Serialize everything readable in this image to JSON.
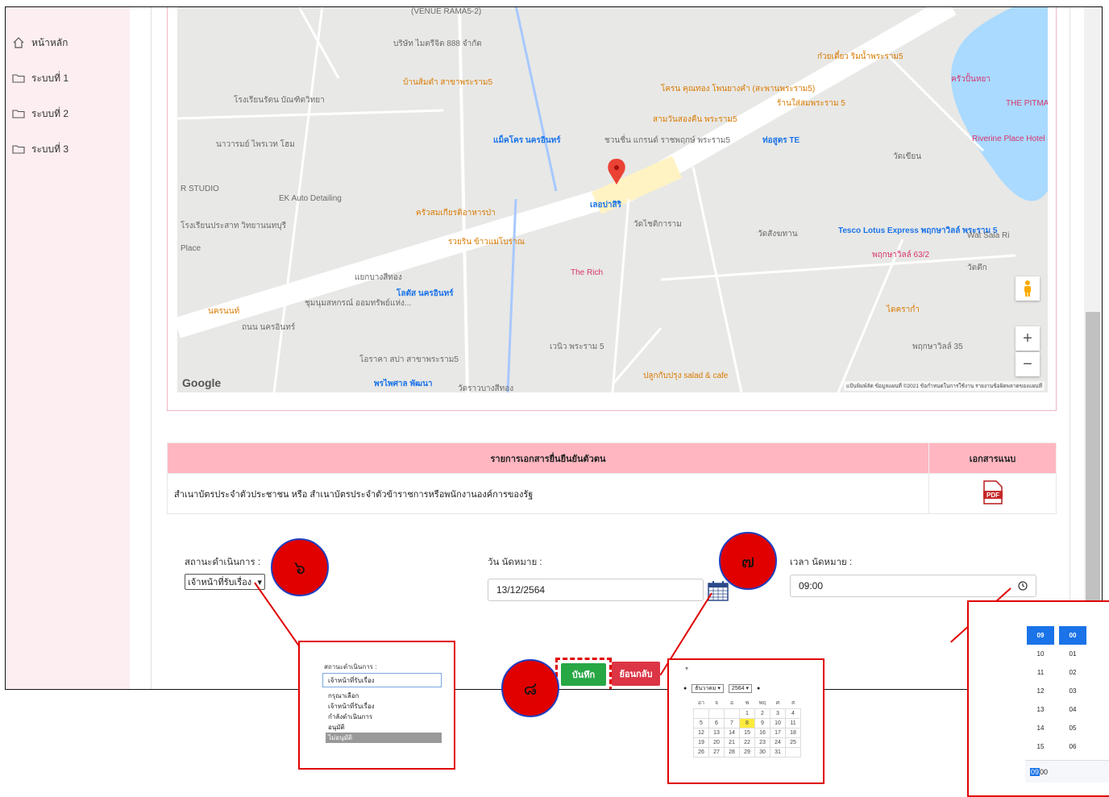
{
  "sidebar": {
    "items": [
      {
        "label": "หน้าหลัก",
        "icon": "home-icon"
      },
      {
        "label": "ระบบที่ 1",
        "icon": "folder-icon"
      },
      {
        "label": "ระบบที่ 2",
        "icon": "folder-icon"
      },
      {
        "label": "ระบบที่ 3",
        "icon": "folder-icon"
      }
    ]
  },
  "map": {
    "labels": [
      "(VENUE RAMA5-2)",
      "บริษัท ไมตรีจิต 888 จำกัด",
      "บ้านส้มตำ สาขาพระราม5",
      "โรงเรียนรัตน บัณฑิตวิทยา",
      "นาวารมย์ ไพรเวท โฮม",
      "แม็คโคร นครอินทร์",
      "ชวนชื่น แกรนด์ ราชพฤกษ์ พระราม5",
      "R STUDIO",
      "EK Auto Detailing",
      "เลอปาสิริ",
      "ครัวสมเกียรติอาหารป่า",
      "วัดไชติการาม",
      "วัดสังฆทาน",
      "Tesco Lotus Express พฤกษาวิลล์ พระราม 5",
      "Wat Sala Ri",
      "พฤกษาวิลล์ 63/2",
      "วัดตึก",
      "รวยริน ข้าวแม่โบราณ",
      "The Rich",
      "แยกบางสีทอง",
      "โลตัส นครอินทร์",
      "ชุมนุมสหกรณ์ ออมทรัพย์แห่ง...",
      "นครนนท์",
      "เวนิว พระราม 5",
      "พฤกษาวิลล์ 35",
      "ไดคราก่ำ",
      "โอราคา สปา สาขาพระราม5",
      "พรไพศาล พัฒนา",
      "วัดราวบางสีทอง",
      "ปลูกกับปรุง salad & cafe",
      "Riverine Place Hotel and Residence",
      "THE PITMAS",
      "ครัวปั้นหยา",
      "ก๋วยเตี๋ยว ริมน้ำพระราม5",
      "โครน คุณทอง โพนยางคำ (สะพานพระราม5)",
      "ร้านใส่สมพระราม 5",
      "สามวันสองคืน พระราม5",
      "ท่อสูตร TE",
      "วัดเขียน",
      "โรงเรียนประสาท วิทยานนทบุรี",
      "Place",
      "ถนน นครอินทร์"
    ],
    "google_logo": "Google",
    "attribution": "แป้นพิมพ์ลัด   ข้อมูลแผนที่ ©2021   ข้อกำหนดในการใช้งาน   รายงานข้อผิดพลาดของแผนที่",
    "zoom_in": "+",
    "zoom_out": "−"
  },
  "docs_table": {
    "header_docs": "รายการเอกสารยื่นยืนยันตัวตน",
    "header_attach": "เอกสารแนบ",
    "rows": [
      {
        "doc": "สำเนาบัตรประจำตัวประชาชน หรือ สำเนาบัตรประจำตัวข้าราชการหรือพนักงานองค์การของรัฐ",
        "attach_icon": "pdf-icon"
      }
    ]
  },
  "form": {
    "status_label": "สถานะดำเนินการ :",
    "status_value": "เจ้าหน้าที่รับเรื่อง",
    "date_label": "วัน นัดหมาย :",
    "date_value": "13/12/2564",
    "time_label": "เวลา นัดหมาย :",
    "time_value": "09:00",
    "save_label": "บันทึก",
    "back_label": "ย้อนกลับ"
  },
  "steps": {
    "s6": "๖",
    "s7": "๗",
    "s8": "๘"
  },
  "dropdown_zoom": {
    "label": "สถานะดำเนินการ :",
    "value": "เจ้าหน้าที่รับเรื่อง",
    "options": [
      "กรุณาเลือก",
      "เจ้าหน้าที่รับเรื่อง",
      "กำลังดำเนินการ",
      "อนุมัติ",
      "ไม่อนุมัติ"
    ],
    "highlighted": "ไม่อนุมัติ"
  },
  "calendar_zoom": {
    "month": "ธันวาคม",
    "year": "2564",
    "weekdays": [
      "อา",
      "จ",
      "อ",
      "พ",
      "พฤ",
      "ศ",
      "ส"
    ],
    "weeks": [
      [
        "",
        "",
        "",
        "1",
        "2",
        "3",
        "4"
      ],
      [
        "5",
        "6",
        "7",
        "8",
        "9",
        "10",
        "11"
      ],
      [
        "12",
        "13",
        "14",
        "15",
        "16",
        "17",
        "18"
      ],
      [
        "19",
        "20",
        "21",
        "22",
        "23",
        "24",
        "25"
      ],
      [
        "26",
        "27",
        "28",
        "29",
        "30",
        "31",
        ""
      ]
    ],
    "today": "8"
  },
  "timepicker_zoom": {
    "hours": [
      "09",
      "10",
      "11",
      "12",
      "13",
      "14",
      "15"
    ],
    "minutes": [
      "00",
      "01",
      "02",
      "03",
      "04",
      "05",
      "06"
    ],
    "selected_hour": "09",
    "selected_minute": "00",
    "input_hour": "09",
    "input_minute": "00"
  },
  "colors": {
    "sidebar_bg": "#fdeef1",
    "table_header_bg": "#ffb6c1",
    "save_green": "#28a745",
    "back_red": "#dc3545",
    "annotation_red": "#e00000",
    "picker_blue": "#1a73e8"
  }
}
